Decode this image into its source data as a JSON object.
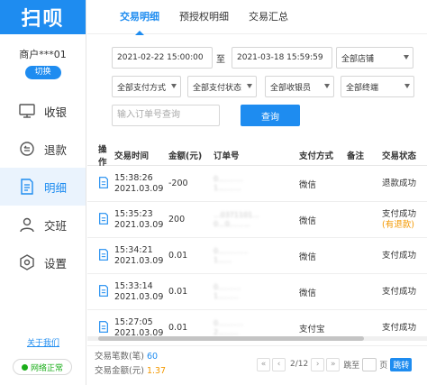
{
  "app": {
    "logo": "扫呗"
  },
  "merchant": {
    "name": "商户***01",
    "switch_label": "切换"
  },
  "nav": [
    {
      "label": "收银",
      "icon": "monitor-icon"
    },
    {
      "label": "退款",
      "icon": "refund-icon"
    },
    {
      "label": "明细",
      "icon": "detail-icon"
    },
    {
      "label": "交班",
      "icon": "shift-icon"
    },
    {
      "label": "设置",
      "icon": "settings-icon"
    }
  ],
  "about_label": "关于我们",
  "network_status": "网络正常",
  "tabs": [
    "交易明细",
    "预授权明细",
    "交易汇总"
  ],
  "filters": {
    "start_time": "2021-02-22 15:00:00",
    "to_label": "至",
    "end_time": "2021-03-18 15:59:59",
    "store": "全部店铺",
    "pay_method": "全部支付方式",
    "pay_status": "全部支付状态",
    "cashier": "全部收银员",
    "terminal": "全部终端",
    "order_placeholder": "输入订单号查询",
    "query_label": "查询"
  },
  "table": {
    "headers": [
      "操作",
      "交易时间",
      "金额(元)",
      "订单号",
      "支付方式",
      "备注",
      "交易状态"
    ],
    "rows": [
      {
        "time": "15:38:26",
        "date": "2021.03.09",
        "amount": "-200",
        "order1": "0...........",
        "order2": "1..........",
        "method": "微信",
        "status": "退款成功",
        "status2": ""
      },
      {
        "time": "15:35:23",
        "date": "2021.03.09",
        "amount": "200",
        "order1": "...0371101...",
        "order2": "0...0.........",
        "method": "微信",
        "status": "支付成功",
        "status2": "(有退款)"
      },
      {
        "time": "15:34:21",
        "date": "2021.03.09",
        "amount": "0.01",
        "order1": "0.............",
        "order2": "1......",
        "method": "微信",
        "status": "支付成功",
        "status2": ""
      },
      {
        "time": "15:33:14",
        "date": "2021.03.09",
        "amount": "0.01",
        "order1": "0..........",
        "order2": "1.........",
        "method": "微信",
        "status": "支付成功",
        "status2": ""
      },
      {
        "time": "15:27:05",
        "date": "2021.03.09",
        "amount": "0.01",
        "order1": "0...........",
        "order2": "2.........",
        "method": "支付宝",
        "status": "支付成功",
        "status2": ""
      }
    ]
  },
  "summary": {
    "count_label": "交易笔数(笔)",
    "count_value": "60",
    "amount_label": "交易金额(元)",
    "amount_value": "1.37"
  },
  "pager": {
    "first": "«",
    "prev": "‹",
    "page": "2/12",
    "next": "›",
    "last": "»",
    "jump_to": "跳至",
    "page_unit": "页",
    "jump_label": "跳转"
  },
  "colors": {
    "accent": "#1e8cf0",
    "orange": "#f39800",
    "success": "#1aad19"
  }
}
